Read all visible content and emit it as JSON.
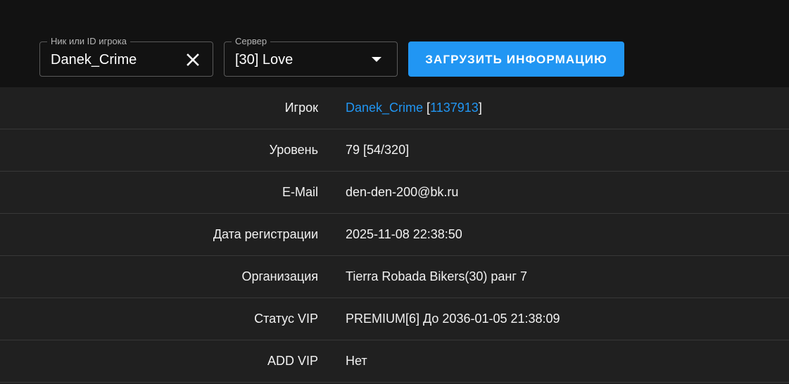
{
  "search": {
    "nick_label": "Ник или ID игрока",
    "nick_value": "Danek_Crime",
    "server_label": "Сервер",
    "server_value": "[30] Love",
    "load_button": "ЗАГРУЗИТЬ ИНФОРМАЦИЮ"
  },
  "player": {
    "rows": [
      {
        "label": "Игрок",
        "name": "Danek_Crime",
        "id": "1137913"
      },
      {
        "label": "Уровень",
        "value": "79 [54/320]"
      },
      {
        "label": "E-Mail",
        "value": "den-den-200@bk.ru"
      },
      {
        "label": "Дата регистрации",
        "value": "2025-11-08 22:38:50"
      },
      {
        "label": "Организация",
        "value": "Tierra Robada Bikers(30) ранг 7"
      },
      {
        "label": "Статус VIP",
        "value": "PREMIUM[6] До 2036-01-05 21:38:09"
      },
      {
        "label": "ADD VIP",
        "value": "Нет"
      }
    ]
  },
  "colors": {
    "accent": "#2196f3",
    "toolbar_bg": "#121212",
    "table_bg": "#202020"
  },
  "icons": {
    "clear": "close-icon",
    "dropdown": "chevron-down-icon"
  }
}
